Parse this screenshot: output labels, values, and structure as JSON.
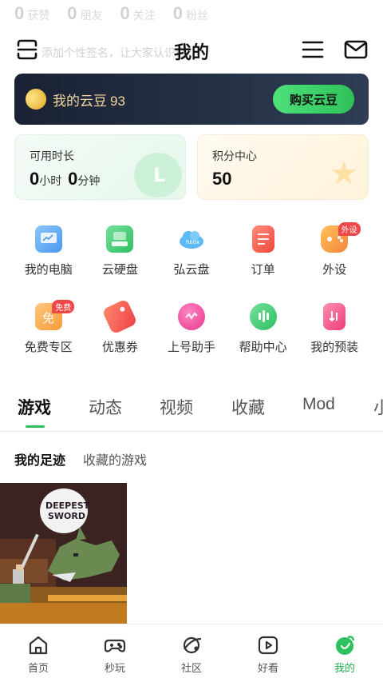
{
  "profile": {
    "stats": [
      {
        "num": "0",
        "label": "获赞"
      },
      {
        "num": "0",
        "label": "朋友"
      },
      {
        "num": "0",
        "label": "关注"
      },
      {
        "num": "0",
        "label": "粉丝"
      }
    ],
    "signature": "添加个性签名，让大家认识你"
  },
  "header": {
    "title": "我的",
    "scan_icon": "scan-icon",
    "menu_icon": "menu-icon",
    "mail_icon": "mail-icon"
  },
  "bean_card": {
    "label": "我的云豆",
    "value": "93",
    "buy_label": "购买云豆"
  },
  "time_card": {
    "title": "可用时长",
    "hours": "0",
    "hours_unit": "小时",
    "minutes": "0",
    "minutes_unit": "分钟"
  },
  "points_card": {
    "title": "积分中心",
    "value": "50"
  },
  "grid": [
    {
      "label": "我的电脑",
      "icon": "computer-icon",
      "color": "#5aa7f5",
      "badge": ""
    },
    {
      "label": "云硬盘",
      "icon": "cloud-disk-icon",
      "color": "#3fcf74",
      "badge": ""
    },
    {
      "label": "弘云盘",
      "icon": "hong-cloud-icon",
      "color": "#56b8f7",
      "badge": ""
    },
    {
      "label": "订单",
      "icon": "order-icon",
      "color": "#f5574b",
      "badge": ""
    },
    {
      "label": "外设",
      "icon": "gamepad-icon",
      "color": "#f59a3b",
      "badge": "外设"
    },
    {
      "label": "免费专区",
      "icon": "free-zone-icon",
      "color": "#f7a542",
      "badge": "免费"
    },
    {
      "label": "优惠券",
      "icon": "coupon-icon",
      "color": "#f4574e",
      "badge": ""
    },
    {
      "label": "上号助手",
      "icon": "login-helper-icon",
      "color": "#f14ea1",
      "badge": ""
    },
    {
      "label": "帮助中心",
      "icon": "help-robot-icon",
      "color": "#3fcf74",
      "badge": ""
    },
    {
      "label": "我的预装",
      "icon": "preinstall-icon",
      "color": "#ef4f86",
      "badge": ""
    }
  ],
  "tabs": [
    "游戏",
    "动态",
    "视频",
    "收藏",
    "Mod",
    "小"
  ],
  "subtabs": [
    "我的足迹",
    "收藏的游戏"
  ],
  "game": {
    "title_line1": "DEEPEST",
    "title_line2": "SWORD"
  },
  "bottom_nav": [
    {
      "label": "首页",
      "icon": "home-icon"
    },
    {
      "label": "秒玩",
      "icon": "gamepad-nav-icon"
    },
    {
      "label": "社区",
      "icon": "community-icon"
    },
    {
      "label": "好看",
      "icon": "video-play-icon"
    },
    {
      "label": "我的",
      "icon": "me-icon"
    }
  ],
  "colors": {
    "accent": "#2ec25e",
    "bean_text": "#f3d9a0",
    "card_dark": "#1a2233"
  }
}
